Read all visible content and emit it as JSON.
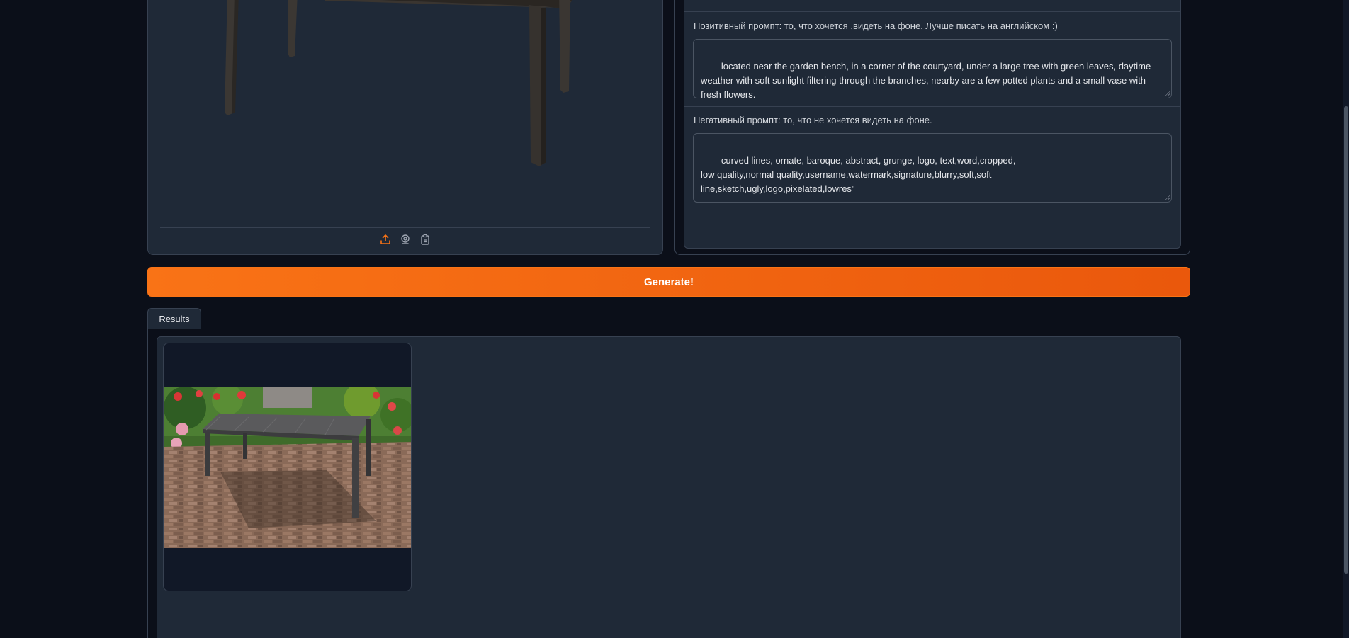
{
  "input_panel": {
    "tools": [
      {
        "icon": "upload-icon",
        "color": "#f97316"
      },
      {
        "icon": "webcam-icon",
        "color": "#9ca3af"
      },
      {
        "icon": "clipboard-icon",
        "color": "#9ca3af"
      }
    ]
  },
  "prompts": {
    "positive_label": "Позитивный промпт: то, что хочется ,видеть на фоне. Лучше писать на английском :)",
    "positive_value": "located near the garden bench, in a corner of the courtyard, under a large tree with green leaves, daytime weather with soft sunlight filtering through the branches, nearby are a few potted plants and a small vase with fresh flowers.",
    "negative_label": "Негативный промпт: то, что не хочется видеть на фоне.",
    "negative_value": "curved lines, ornate, baroque, abstract, grunge, logo, text,word,cropped,\nlow quality,normal quality,username,watermark,signature,blurry,soft,soft\nline,sketch,ugly,logo,pixelated,lowres\""
  },
  "generate_button": {
    "label": "Generate!",
    "color": "#f97316"
  },
  "results": {
    "tab_label": "Results"
  },
  "theme": {
    "background": "#0b0f19",
    "panel": "#1f2937",
    "border": "#374151",
    "accent": "#f97316"
  }
}
